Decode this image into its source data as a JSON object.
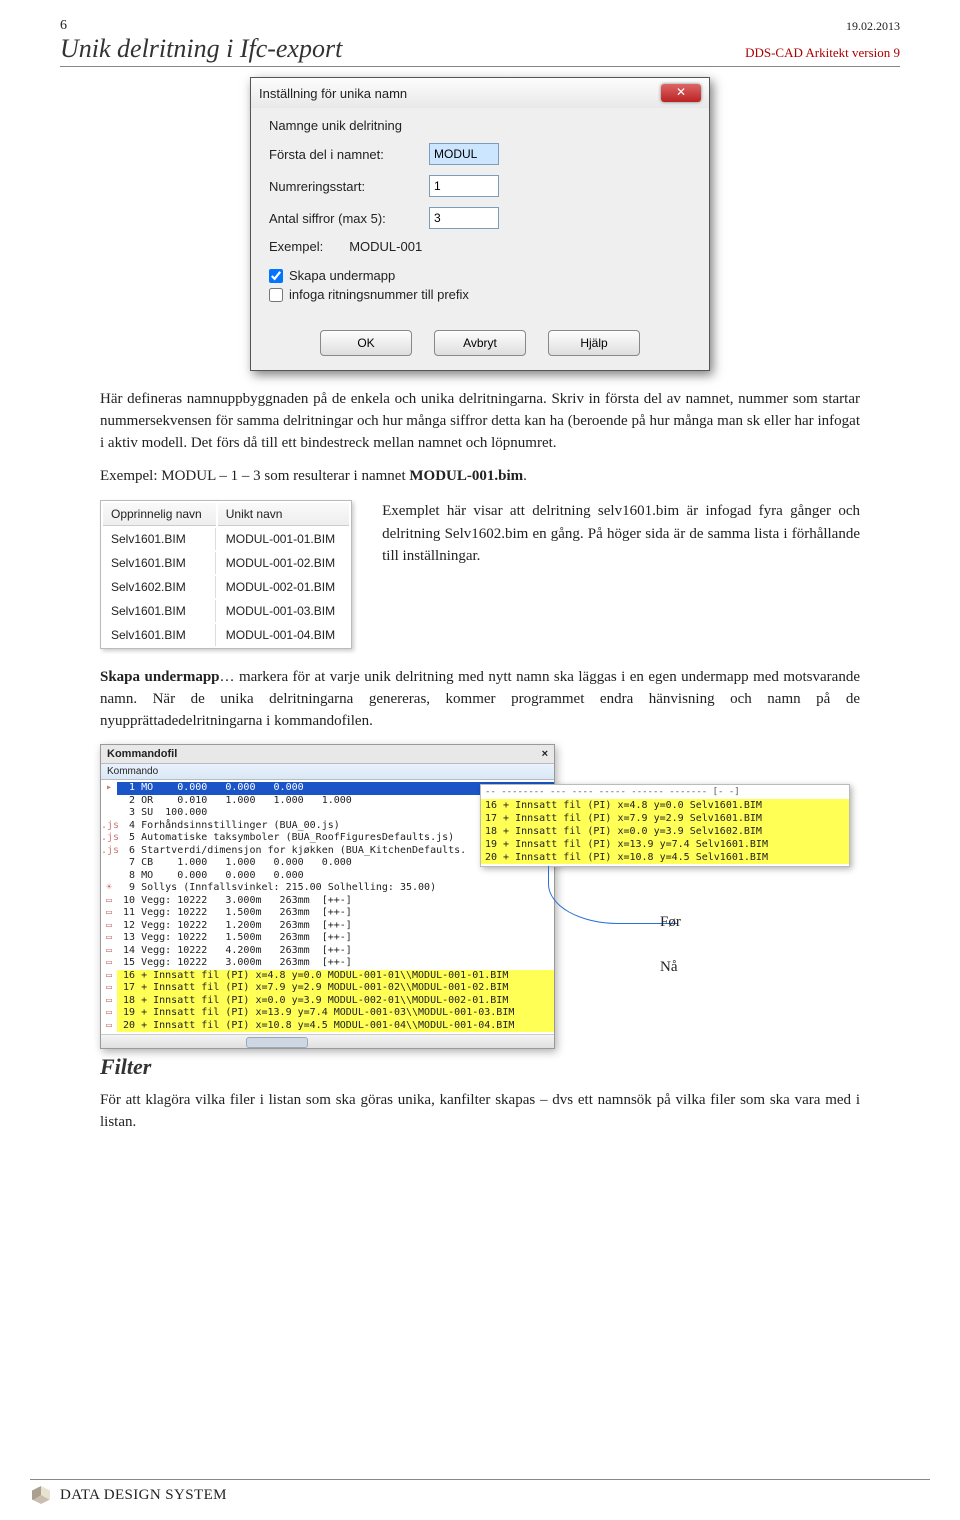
{
  "header": {
    "page_number": "6",
    "date": "19.02.2013",
    "title": "Unik delritning i Ifc-export",
    "subtitle": "DDS-CAD Arkitekt version 9"
  },
  "dialog": {
    "title": "Inställning för unika namn",
    "close_glyph": "✕",
    "legend": "Namnge unik delritning",
    "lbl_first": "Första del i namnet:",
    "val_first": "MODUL",
    "lbl_numstart": "Numreringsstart:",
    "val_numstart": "1",
    "lbl_digits": "Antal siffror (max 5):",
    "val_digits": "3",
    "lbl_example": "Exempel:",
    "val_example": "MODUL-001",
    "chk1": "Skapa undermapp",
    "chk2": "infoga ritningsnummer till prefix",
    "btn_ok": "OK",
    "btn_cancel": "Avbryt",
    "btn_help": "Hjälp"
  },
  "para1": "Här defineras namnuppbyggnaden på de enkela och unika delritningarna. Skriv in första del av namnet, nummer som startar nummersekvensen för samma delritningar och hur många siffror detta kan ha (beroende på hur många man sk eller har infogat  i aktiv modell. Det förs då till ett bindestreck mellan namnet och löpnumret.",
  "para2_pre": "Exempel:  MODUL – 1 – 3 som resulterar i namnet ",
  "para2_strong": "MODUL-001.bim",
  "para2_post": ".",
  "name_table": {
    "col1": "Opprinnelig navn",
    "col2": "Unikt navn",
    "rows": [
      [
        "Selv1601.BIM",
        "MODUL-001-01.BIM"
      ],
      [
        "Selv1601.BIM",
        "MODUL-001-02.BIM"
      ],
      [
        "Selv1602.BIM",
        "MODUL-002-01.BIM"
      ],
      [
        "Selv1601.BIM",
        "MODUL-001-03.BIM"
      ],
      [
        "Selv1601.BIM",
        "MODUL-001-04.BIM"
      ]
    ]
  },
  "side_note": "Exemplet här visar att delritning selv1601.bim är infogad fyra gånger och delritning Selv1602.bim en gång. På höger sida är de samma lista i förhållande till inställningar.",
  "para3_strong": "Skapa undermapp",
  "para3_rest": "… markera  för at varje unik delritning med nytt namn ska läggas i en egen undermapp med motsvarande namn. När de unika delritningarna genereras, kommer programmet  endra hänvisning och namn på de nyupprättadedelritningarna i kommandofilen.",
  "kommandofil": {
    "title": "Kommandofil",
    "close": "×",
    "sub": "Kommando",
    "lines": [
      {
        "ico": "▸",
        "txt": "  1 MO    0.000   0.000   0.000",
        "cls": "selblue"
      },
      {
        "ico": "",
        "txt": "  2 OR    0.010   1.000   1.000   1.000",
        "cls": ""
      },
      {
        "ico": "",
        "txt": "  3 SU  100.000",
        "cls": ""
      },
      {
        "ico": ".js",
        "txt": "  4 Forhåndsinnstillinger (BUA_00.js)",
        "cls": ""
      },
      {
        "ico": ".js",
        "txt": "  5 Automatiske taksymboler (BUA_RoofFiguresDefaults.js)",
        "cls": ""
      },
      {
        "ico": ".js",
        "txt": "  6 Startverdi/dimensjon for kjøkken (BUA_KitchenDefaults.",
        "cls": ""
      },
      {
        "ico": "",
        "txt": "  7 CB    1.000   1.000   0.000   0.000",
        "cls": ""
      },
      {
        "ico": "",
        "txt": "  8 MO    0.000   0.000   0.000",
        "cls": ""
      },
      {
        "ico": "☀",
        "txt": "  9 Sollys (Innfallsvinkel: 215.00 Solhelling: 35.00)",
        "cls": ""
      },
      {
        "ico": "▭",
        "txt": " 10 Vegg: 10222   3.000m   263mm  [++-]",
        "cls": ""
      },
      {
        "ico": "▭",
        "txt": " 11 Vegg: 10222   1.500m   263mm  [++-]",
        "cls": ""
      },
      {
        "ico": "▭",
        "txt": " 12 Vegg: 10222   1.200m   263mm  [++-]",
        "cls": ""
      },
      {
        "ico": "▭",
        "txt": " 13 Vegg: 10222   1.500m   263mm  [++-]",
        "cls": ""
      },
      {
        "ico": "▭",
        "txt": " 14 Vegg: 10222   4.200m   263mm  [++-]",
        "cls": ""
      },
      {
        "ico": "▭",
        "txt": " 15 Vegg: 10222   3.000m   263mm  [++-]",
        "cls": ""
      },
      {
        "ico": "▭",
        "txt": " 16 + Innsatt fil (PI) x=4.8 y=0.0 MODUL-001-01\\\\MODUL-001-01.BIM",
        "cls": "hl"
      },
      {
        "ico": "▭",
        "txt": " 17 + Innsatt fil (PI) x=7.9 y=2.9 MODUL-001-02\\\\MODUL-001-02.BIM",
        "cls": "hl"
      },
      {
        "ico": "▭",
        "txt": " 18 + Innsatt fil (PI) x=0.0 y=3.9 MODUL-002-01\\\\MODUL-002-01.BIM",
        "cls": "hl"
      },
      {
        "ico": "▭",
        "txt": " 19 + Innsatt fil (PI) x=13.9 y=7.4 MODUL-001-03\\\\MODUL-001-03.BIM",
        "cls": "hl"
      },
      {
        "ico": "▭",
        "txt": " 20 + Innsatt fil (PI) x=10.8 y=4.5 MODUL-001-04\\\\MODUL-001-04.BIM",
        "cls": "hl"
      }
    ]
  },
  "inset": {
    "plain_lines": [
      "-- -------- --- ---- ----- ------ ------- [- -]"
    ],
    "hl_lines": [
      "16 + Innsatt fil (PI) x=4.8 y=0.0 Selv1601.BIM",
      "17 + Innsatt fil (PI) x=7.9 y=2.9 Selv1601.BIM",
      "18 + Innsatt fil (PI) x=0.0 y=3.9 Selv1602.BIM",
      "19 + Innsatt fil (PI) x=13.9 y=7.4 Selv1601.BIM",
      "20 + Innsatt fil (PI) x=10.8 y=4.5 Selv1601.BIM"
    ]
  },
  "label_before": "Før",
  "label_now": "Nå",
  "filter": {
    "heading": "Filter",
    "text": "För att klagöra vilka filer i listan som ska göras unika, kanfilter skapas – dvs ett namnsök på vilka filer som ska vara med i listan."
  },
  "footer": {
    "brand_a": "D",
    "brand_b": "ATA ",
    "brand_c": "D",
    "brand_d": "ESIGN ",
    "brand_e": "S",
    "brand_f": "YSTEM"
  }
}
